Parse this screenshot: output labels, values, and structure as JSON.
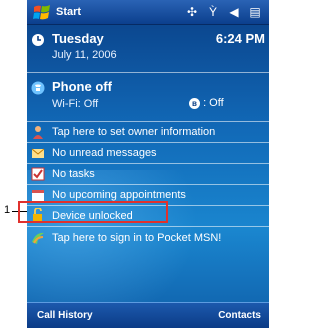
{
  "callout": {
    "number": "1"
  },
  "titlebar": {
    "title": "Start"
  },
  "today": {
    "day": "Tuesday",
    "date": "July 11, 2006",
    "time": "6:24 PM"
  },
  "phone": {
    "status": "Phone off",
    "wifi": "Wi-Fi: Off",
    "bluetooth": ": Off"
  },
  "items": [
    {
      "icon": "owner-icon",
      "label": "Tap here to set owner information"
    },
    {
      "icon": "messages-icon",
      "label": "No unread messages"
    },
    {
      "icon": "tasks-icon",
      "label": "No tasks"
    },
    {
      "icon": "calendar-icon",
      "label": "No upcoming appointments"
    },
    {
      "icon": "lock-icon",
      "label": "Device unlocked"
    },
    {
      "icon": "msn-icon",
      "label": "Tap here to sign in to Pocket MSN!"
    }
  ],
  "softkeys": {
    "left": "Call History",
    "right": "Contacts"
  },
  "colors": {
    "highlight": "#e0312d",
    "titlebar": "#0b3f8d"
  }
}
